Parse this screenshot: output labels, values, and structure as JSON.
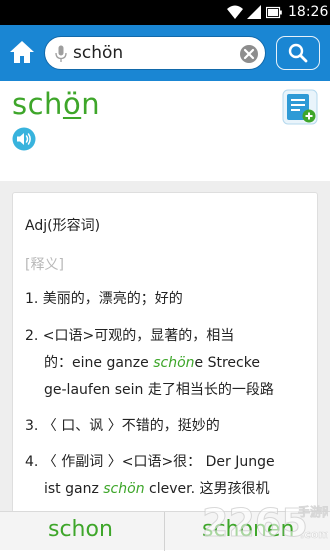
{
  "status_bar": {
    "time": "18:26"
  },
  "search": {
    "value": "schön"
  },
  "headword": {
    "prefix": "sch",
    "underlined": "ö",
    "suffix": "n"
  },
  "entry": {
    "part_of_speech": "Adj(形容词)",
    "section_label": "[释义]",
    "definitions": {
      "d1": {
        "line1": "1. 美丽的，漂亮的；好的"
      },
      "d2": {
        "line1": "2. <口语>可观的，显著的，相当",
        "line2_prefix": "的：eine ganze ",
        "line2_example": "schön",
        "line2_suffix": "e Strecke",
        "line3": "ge-laufen sein 走了相当长的一段路"
      },
      "d3": {
        "line1": "3. 〈 口、讽 〉不错的，挺妙的"
      },
      "d4": {
        "line1": "4. 〈 作副词 〉<口语>很：  Der Junge",
        "line2_prefix": "ist ganz ",
        "line2_example": "schön",
        "line2_suffix": " clever. 这男孩很机"
      }
    }
  },
  "bottom_nav": {
    "previous": "schon",
    "next": "schonen"
  },
  "watermark": {
    "number": "2265",
    "suffix": ".com",
    "site": "手游网"
  },
  "colors": {
    "header": "#1a86d3",
    "accent_green": "#3ea62a"
  },
  "icons": {
    "home": "home-icon",
    "mic": "mic-icon",
    "clear": "clear-icon",
    "search": "search-icon",
    "speaker": "speaker-icon",
    "wordbook": "add-to-wordbook-icon"
  }
}
